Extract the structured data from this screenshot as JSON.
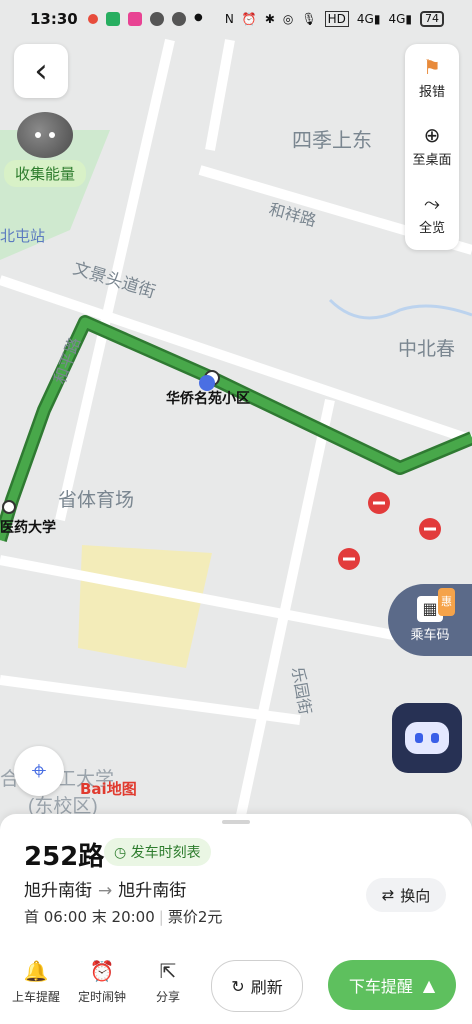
{
  "status_bar": {
    "time": "13:30",
    "battery": "74"
  },
  "map": {
    "labels": {
      "district_east": "四季上东",
      "road_hexiang": "和祥路",
      "station_beitun": "北屯站",
      "road_wenjing": "文景头道街",
      "area_zhongbeichun": "中北春",
      "stop_huaqiao": "华侨名苑小区",
      "road_heping": "和平路",
      "area_sport": "省体育场",
      "stop_medical": "医药大学",
      "road_leyuan": "乐园街",
      "university": "合肥理工大学",
      "campus": "(东校区)",
      "baidu_map": "Bai地图"
    },
    "energy_label": "收集能量",
    "tools": {
      "report": "报错",
      "desktop": "至桌面",
      "overview": "全览"
    },
    "ride_code": {
      "label": "乘车码",
      "badge": "惠"
    }
  },
  "bus": {
    "route": "252路",
    "timetable_label": "发车时刻表",
    "from": "旭升南街",
    "to": "旭升南街",
    "switch_label": "换向",
    "hours": "首 06:00 末 20:00",
    "fare": "票价2元"
  },
  "actions": {
    "boarding_alert": "上车提醒",
    "alarm": "定时闹钟",
    "share": "分享",
    "refresh": "刷新",
    "alight_alert": "下车提醒"
  },
  "colors": {
    "route_green": "#3c9b40",
    "accent_green": "#5ec05e",
    "stop_blue": "#4a6fe3"
  }
}
